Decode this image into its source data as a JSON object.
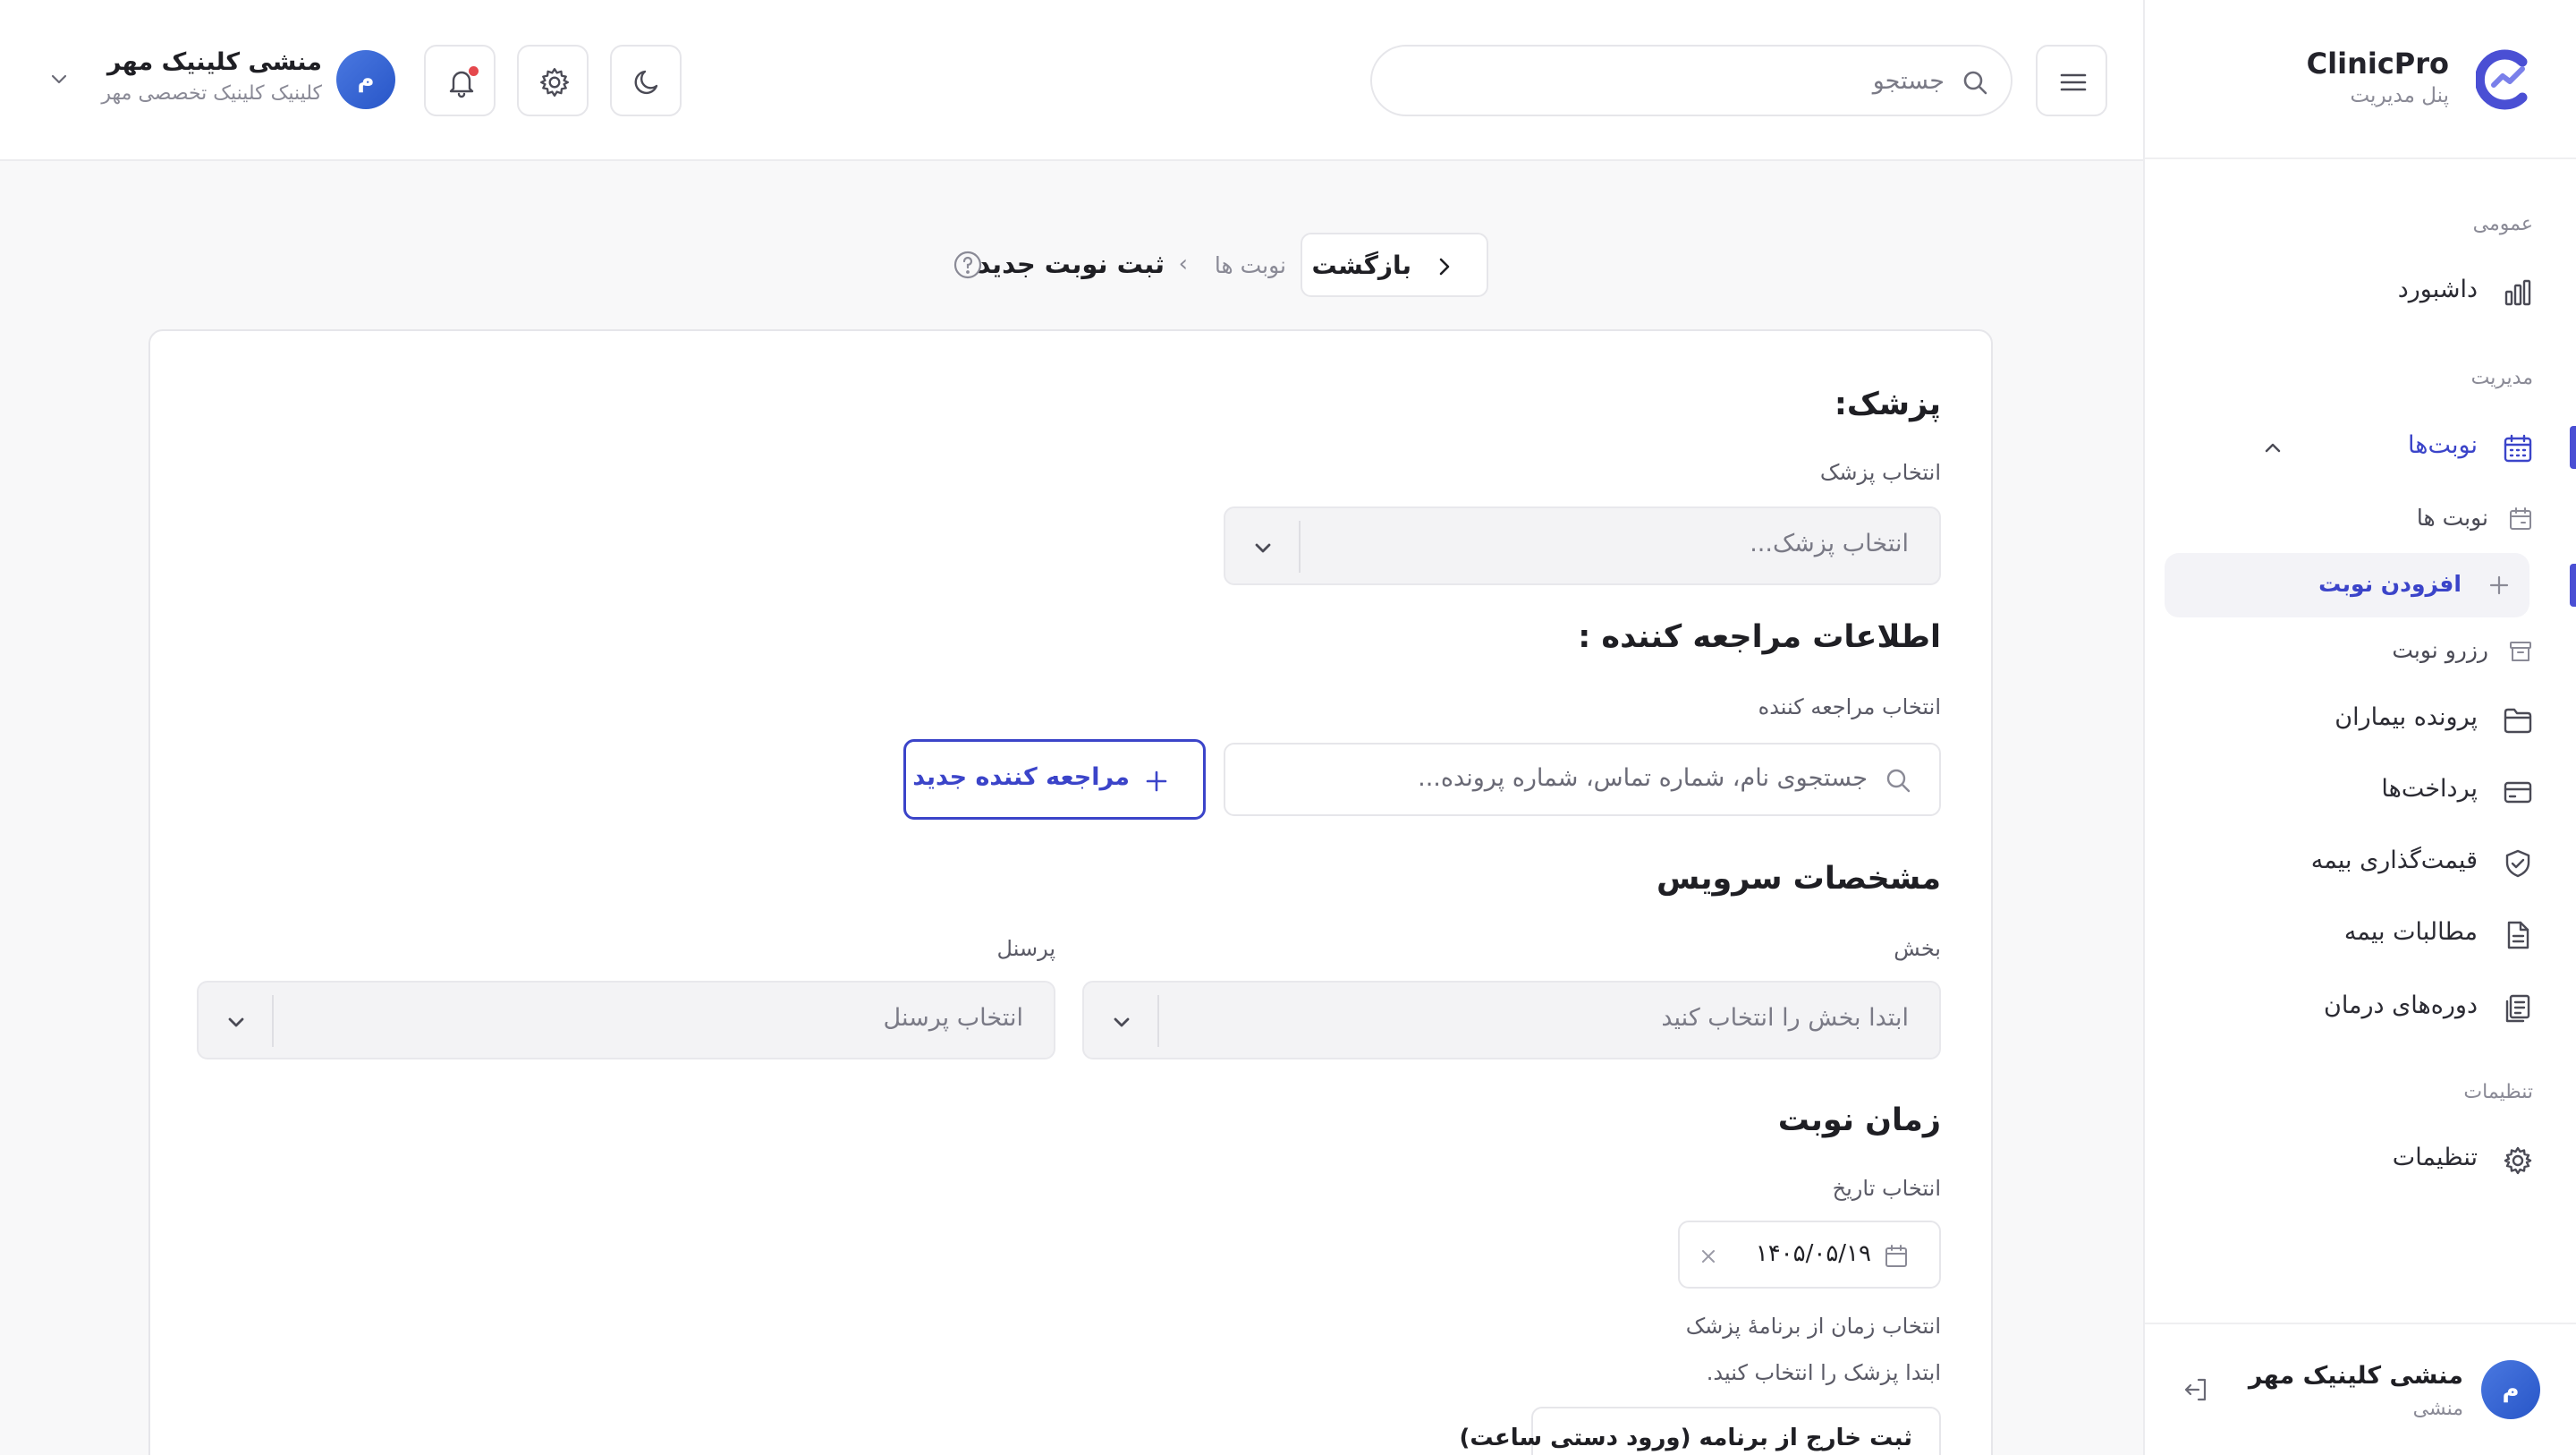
{
  "sidebar": {
    "brand": {
      "name": "ClinicPro",
      "subtitle": "پنل مدیریت"
    },
    "sections": {
      "general": "عمومی",
      "management": "مدیریت",
      "settings": "تنظیمات"
    },
    "items": {
      "dashboard": "داشبورد",
      "appointments": "نوبت‌ها",
      "appointments_list": "نوبت ها",
      "add_appointment": "افزودن نوبت",
      "reserve_appointment": "رزرو نوبت",
      "patient_files": "پرونده بیماران",
      "payments": "پرداخت‌ها",
      "insurance_pricing": "قیمت‌گذاری بیمه",
      "insurance_claims": "مطالبات بیمه",
      "treatment_courses": "دوره‌های درمان",
      "settings": "تنظیمات"
    },
    "footer": {
      "avatar_initial": "م",
      "name": "منشی کلینیک مهر",
      "role": "منشی"
    }
  },
  "header": {
    "search_placeholder": "جستجو",
    "user": {
      "avatar_initial": "م",
      "name": "منشی کلینیک مهر",
      "clinic": "کلینیک کلینیک تخصصی مهر"
    }
  },
  "breadcrumb": {
    "back_label": "بازگشت",
    "parent": "نوبت ها",
    "separator": "›",
    "current": "ثبت نوبت جدید"
  },
  "form": {
    "doctor_section": "پزشک:",
    "doctor_label": "انتخاب پزشک",
    "doctor_placeholder": "انتخاب پزشک...",
    "patient_section": "اطلاعات مراجعه کننده :",
    "patient_label": "انتخاب مراجعه کننده",
    "patient_search_placeholder": "جستجوی نام، شماره تماس، شماره پرونده...",
    "new_patient_button": "مراجعه کننده جدید",
    "service_section": "مشخصات سرویس",
    "department_label": "بخش",
    "department_placeholder": "ابتدا بخش را انتخاب کنید",
    "staff_label": "پرسنل",
    "staff_placeholder": "انتخاب پرسنل",
    "time_section": "زمان نوبت",
    "date_label": "انتخاب تاریخ",
    "date_value": "۱۴۰۵/۰۵/۱۹",
    "schedule_label": "انتخاب زمان از برنامهٔ پزشک",
    "schedule_hint": "ابتدا پزشک را انتخاب کنید.",
    "manual_button": "ثبت خارج از برنامه (ورود دستی ساعت)"
  },
  "colors": {
    "accent": "#3b44c9",
    "notification_dot": "#e5484d",
    "avatar": "#2f62d0"
  },
  "icons": {
    "logo": "clinicpro-logo-icon",
    "menu": "hamburger-icon",
    "search": "search-icon",
    "theme": "moon-icon",
    "settings": "gear-icon",
    "notifications": "bell-icon"
  }
}
